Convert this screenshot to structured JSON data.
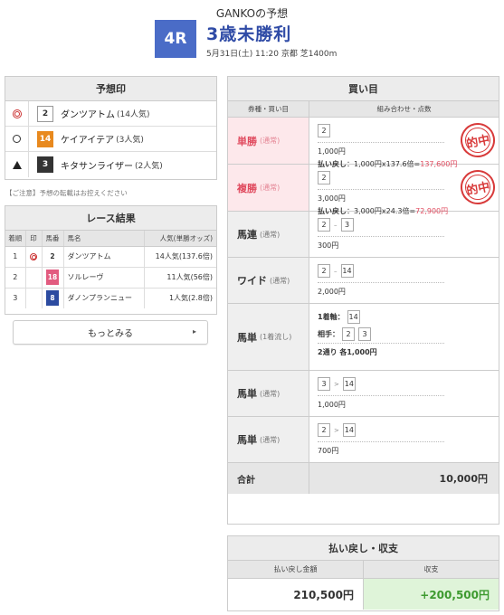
{
  "header": {
    "title": "GANKOの予想",
    "race_no": "4R",
    "race_name": "3歳未勝利",
    "race_info": "5月31日(土) 11:20 京都 芝1400m"
  },
  "prediction": {
    "heading": "予想印",
    "rows": [
      {
        "mark": "double-circle",
        "num": "2",
        "color": "white",
        "horse": "ダンツアトム",
        "pop": "(14人気)"
      },
      {
        "mark": "circle",
        "num": "14",
        "color": "orange",
        "horse": "ケイアイテア",
        "pop": "(3人気)"
      },
      {
        "mark": "triangle",
        "num": "3",
        "color": "black",
        "horse": "キタサンライザー",
        "pop": "(2人気)"
      }
    ]
  },
  "notice": "【ご注意】予想の転載はお控えください",
  "results": {
    "heading": "レース結果",
    "columns": [
      "着順",
      "印",
      "馬番",
      "馬名",
      "人気(単勝オッズ)"
    ],
    "rows": [
      {
        "rank": "1",
        "mark": "double-circle",
        "num": "2",
        "color": "white",
        "horse": "ダンツアトム",
        "pop": "14人気(137.6倍)"
      },
      {
        "rank": "2",
        "mark": "",
        "num": "18",
        "color": "pink",
        "horse": "ソルレーヴ",
        "pop": "11人気(56倍)"
      },
      {
        "rank": "3",
        "mark": "",
        "num": "8",
        "color": "blue",
        "horse": "ダノンプランニュー",
        "pop": "1人気(2.8倍)"
      }
    ],
    "more_label": "もっとみる"
  },
  "bets": {
    "heading": "買い目",
    "col_type": "券種・買い目",
    "col_combo": "組み合わせ・点数",
    "hit_stamp": "的中",
    "rows": [
      {
        "type": "単勝",
        "kind": "(通常)",
        "hit": true,
        "nums": [
          "2"
        ],
        "amount": "1,000円",
        "payout_label": "払い戻し",
        "payout_calc": "：1,000円x137.6倍=",
        "payout_value": "137,600円"
      },
      {
        "type": "複勝",
        "kind": "(通常)",
        "hit": true,
        "nums": [
          "2"
        ],
        "amount": "3,000円",
        "payout_label": "払い戻し",
        "payout_calc": "：3,000円x24.3倍=",
        "payout_value": "72,900円"
      },
      {
        "type": "馬連",
        "kind": "(通常)",
        "hit": false,
        "nums": [
          "2",
          "3"
        ],
        "sep": "–",
        "amount": "300円"
      },
      {
        "type": "ワイド",
        "kind": "(通常)",
        "hit": false,
        "nums": [
          "2",
          "14"
        ],
        "sep": "–",
        "amount": "2,000円"
      },
      {
        "type": "馬単",
        "kind": "(1着流し)",
        "hit": false,
        "axis_label": "1着軸：",
        "axis": [
          "14"
        ],
        "partner_label": "相手：",
        "partners": [
          "2",
          "3"
        ],
        "amount": "2通り 各1,000円"
      },
      {
        "type": "馬単",
        "kind": "(通常)",
        "hit": false,
        "nums": [
          "3",
          "14"
        ],
        "sep": ">",
        "amount": "1,000円"
      },
      {
        "type": "馬単",
        "kind": "(通常)",
        "hit": false,
        "nums": [
          "2",
          "14"
        ],
        "sep": ">",
        "amount": "700円"
      }
    ],
    "total_label": "合計",
    "total_value": "10,000円"
  },
  "summary": {
    "heading": "払い戻し・収支",
    "col_return": "払い戻し金額",
    "col_balance": "収支",
    "return_value": "210,500円",
    "balance_value": "+200,500円"
  },
  "colors": {
    "badge": "#4a6cc7",
    "race_name": "#2f4ba6",
    "hit_red": "#e04a5e",
    "plus_green": "#3d9a2f"
  }
}
